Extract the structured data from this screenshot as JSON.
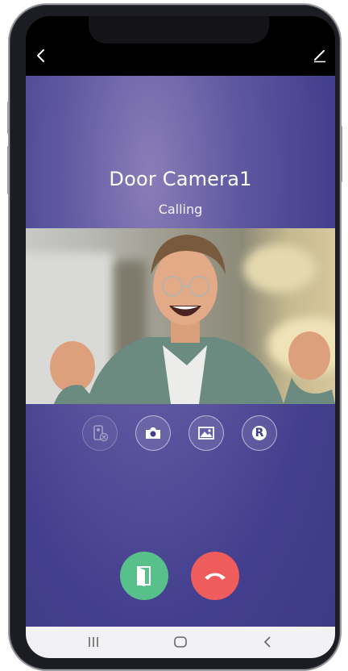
{
  "call": {
    "device_name": "Door Camera1",
    "status_text": "Calling"
  },
  "topbar": {
    "back_icon": "chevron-left-icon",
    "edit_icon": "pencil-icon"
  },
  "controls": [
    {
      "id": "intercom",
      "icon": "intercom-disabled-icon",
      "enabled": false
    },
    {
      "id": "snapshot",
      "icon": "camera-icon",
      "enabled": true
    },
    {
      "id": "gallery",
      "icon": "image-icon",
      "enabled": true
    },
    {
      "id": "record",
      "icon": "record-r-icon",
      "label": "R",
      "enabled": true
    }
  ],
  "call_actions": {
    "open_door": {
      "icon": "door-open-icon",
      "color": "#58c08a"
    },
    "hang_up": {
      "icon": "phone-hangup-icon",
      "color": "#ef5c5c"
    }
  },
  "navbar": {
    "items": [
      "recent-apps-icon",
      "home-icon",
      "back-icon"
    ]
  },
  "colors": {
    "background": "#433f8e",
    "accept": "#58c08a",
    "decline": "#ef5c5c"
  }
}
